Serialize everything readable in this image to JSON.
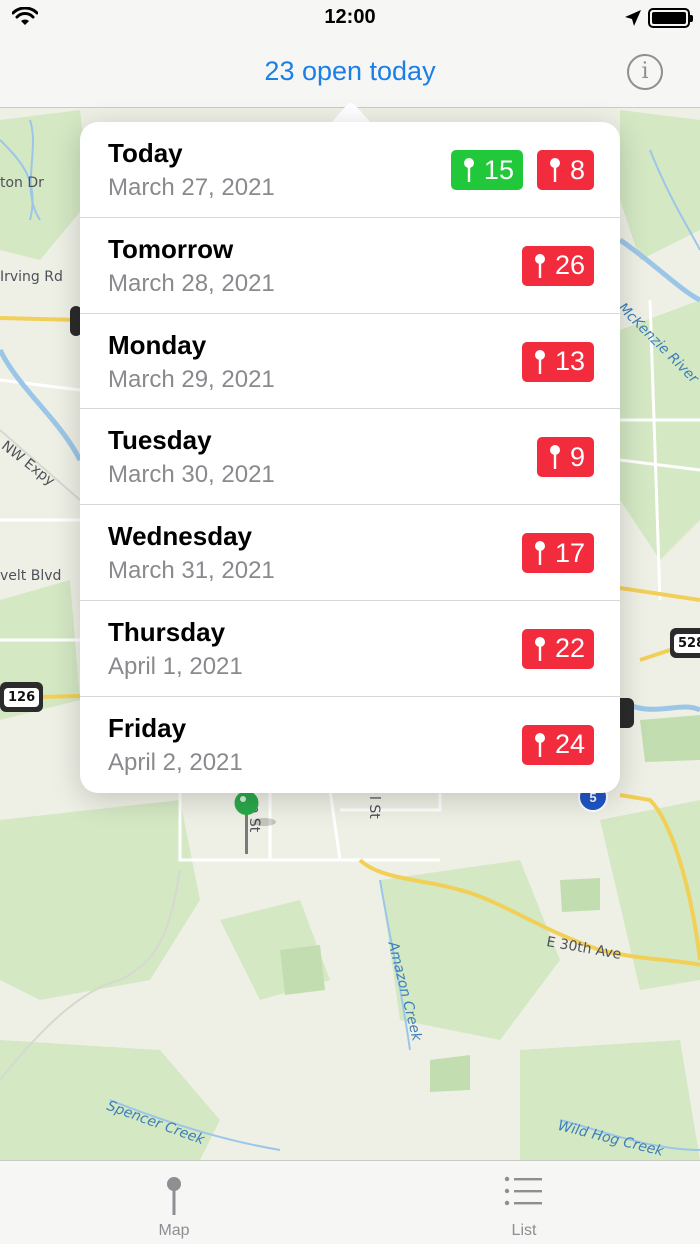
{
  "status_bar": {
    "time": "12:00"
  },
  "nav": {
    "title": "23 open today",
    "info_icon": "info-icon"
  },
  "map_labels": {
    "road_1": "ton Dr",
    "road_2": "Irving Rd",
    "road_3": "NW Expy",
    "road_4": "velt Blvd",
    "road_5": "E 30th Ave",
    "road_6": "on St",
    "road_7": "l St",
    "water_1": "McKenzie River",
    "water_2": "Amazon Creek",
    "water_3": "Spencer Creek",
    "water_4": "Wild Hog Creek",
    "shield_1": "126",
    "shield_2": "528",
    "shield_3": "5"
  },
  "days": [
    {
      "day": "Today",
      "date": "March 27, 2021",
      "badges": [
        {
          "color": "green",
          "count": "15"
        },
        {
          "color": "red",
          "count": "8"
        }
      ]
    },
    {
      "day": "Tomorrow",
      "date": "March 28, 2021",
      "badges": [
        {
          "color": "red",
          "count": "26"
        }
      ]
    },
    {
      "day": "Monday",
      "date": "March 29, 2021",
      "badges": [
        {
          "color": "red",
          "count": "13"
        }
      ]
    },
    {
      "day": "Tuesday",
      "date": "March 30, 2021",
      "badges": [
        {
          "color": "red",
          "count": "9"
        }
      ]
    },
    {
      "day": "Wednesday",
      "date": "March 31, 2021",
      "badges": [
        {
          "color": "red",
          "count": "17"
        }
      ]
    },
    {
      "day": "Thursday",
      "date": "April 1, 2021",
      "badges": [
        {
          "color": "red",
          "count": "22"
        }
      ]
    },
    {
      "day": "Friday",
      "date": "April 2, 2021",
      "badges": [
        {
          "color": "red",
          "count": "24"
        }
      ]
    }
  ],
  "tabs": [
    {
      "label": "Map",
      "icon": "pin-icon"
    },
    {
      "label": "List",
      "icon": "list-icon"
    }
  ],
  "colors": {
    "accent": "#1a7fe6",
    "badge_red": "#f22b3d",
    "badge_green": "#20c83a",
    "pin_green": "#2ba84a"
  }
}
